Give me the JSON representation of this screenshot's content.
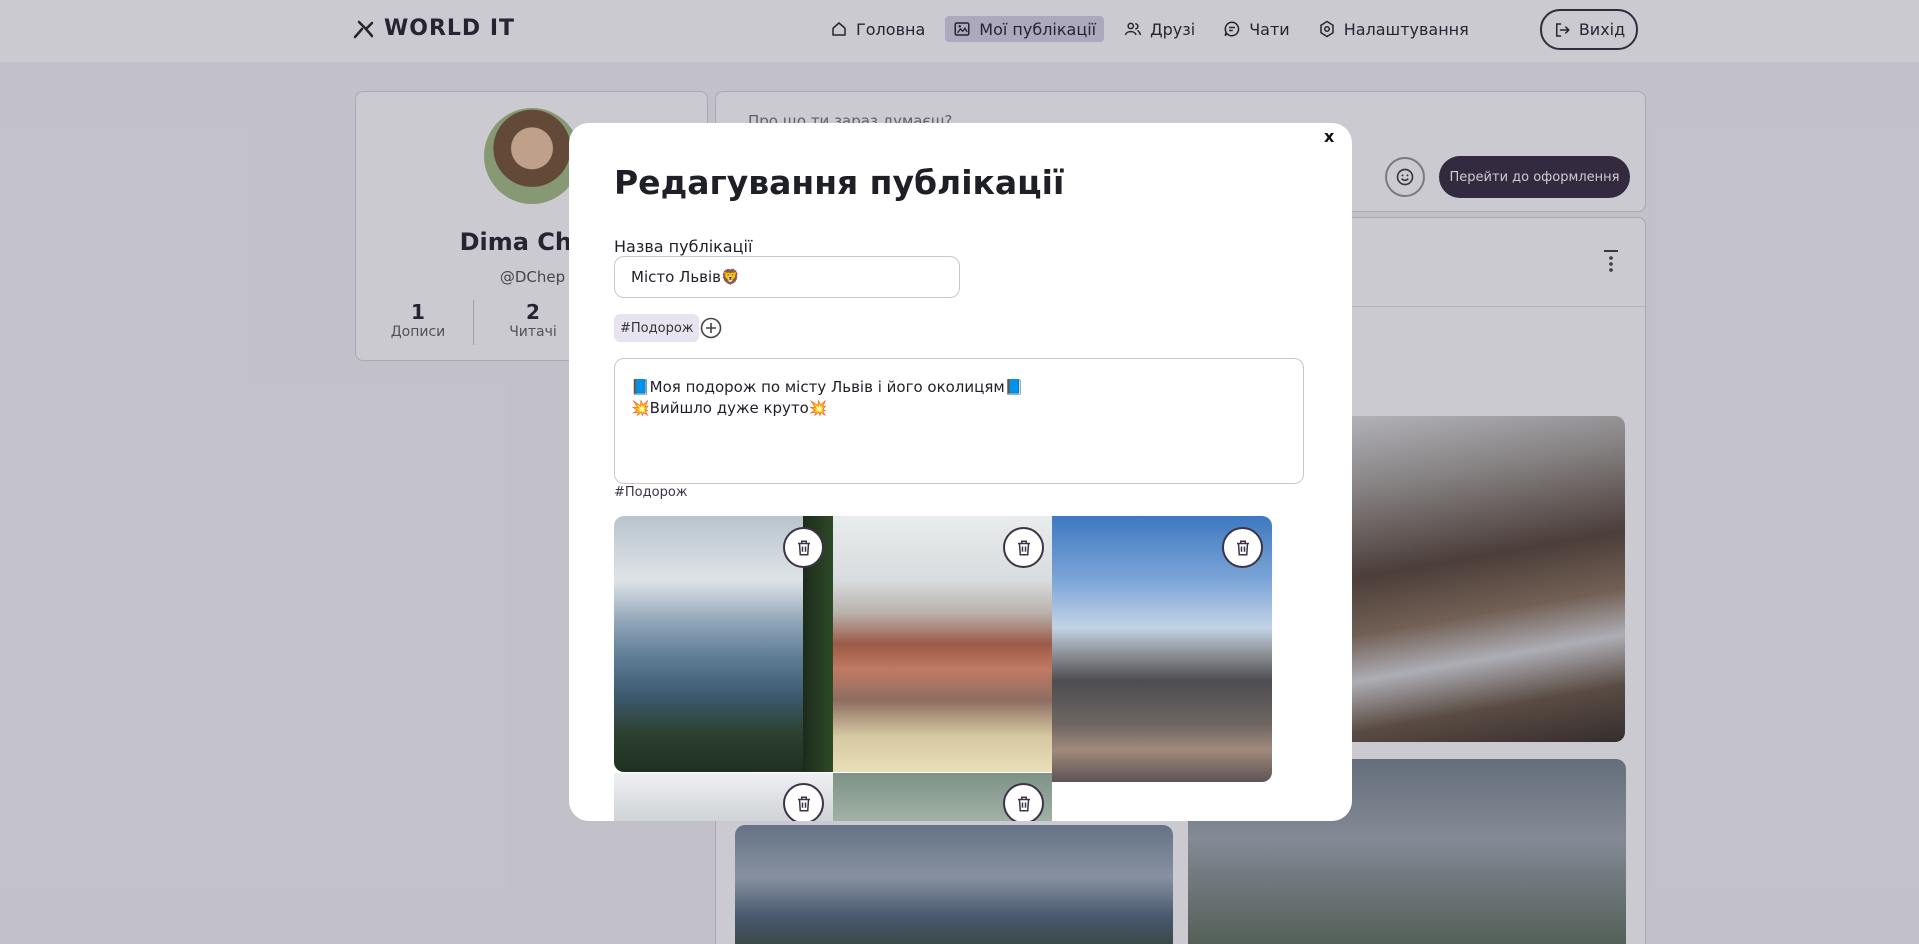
{
  "header": {
    "logo_text": "WORLD IT",
    "nav": [
      {
        "label": "Головна",
        "icon": "home-icon",
        "active": false
      },
      {
        "label": "Мої публікації",
        "icon": "image-icon",
        "active": true
      },
      {
        "label": "Друзі",
        "icon": "friends-icon",
        "active": false
      },
      {
        "label": "Чати",
        "icon": "chat-icon",
        "active": false
      },
      {
        "label": "Налаштування",
        "icon": "gear-icon",
        "active": false
      }
    ],
    "logout_label": "Вихід"
  },
  "profile": {
    "name": "Dima Chep",
    "handle": "@DChep",
    "stats": [
      {
        "value": "1",
        "label": "Дописи"
      },
      {
        "value": "2",
        "label": "Читачі"
      }
    ]
  },
  "composer": {
    "placeholder": "Про що ти зараз думаєш?",
    "design_button": "Перейти до оформлення"
  },
  "modal": {
    "title": "Редагування публікації",
    "close_label": "x",
    "name_label": "Назва публікації",
    "name_value": "Місто Львів🦁",
    "tags": [
      "#Подорож"
    ],
    "body_text": "📘Моя подорож по місту Львів і його околицям📘\n💥Вийшло дуже круто💥",
    "hashtag_line": "#Подорож"
  },
  "colors": {
    "accent": "#3e3346",
    "tag_bg": "#e8e3f0",
    "overlay": "rgba(20,14,40,0.22)"
  }
}
